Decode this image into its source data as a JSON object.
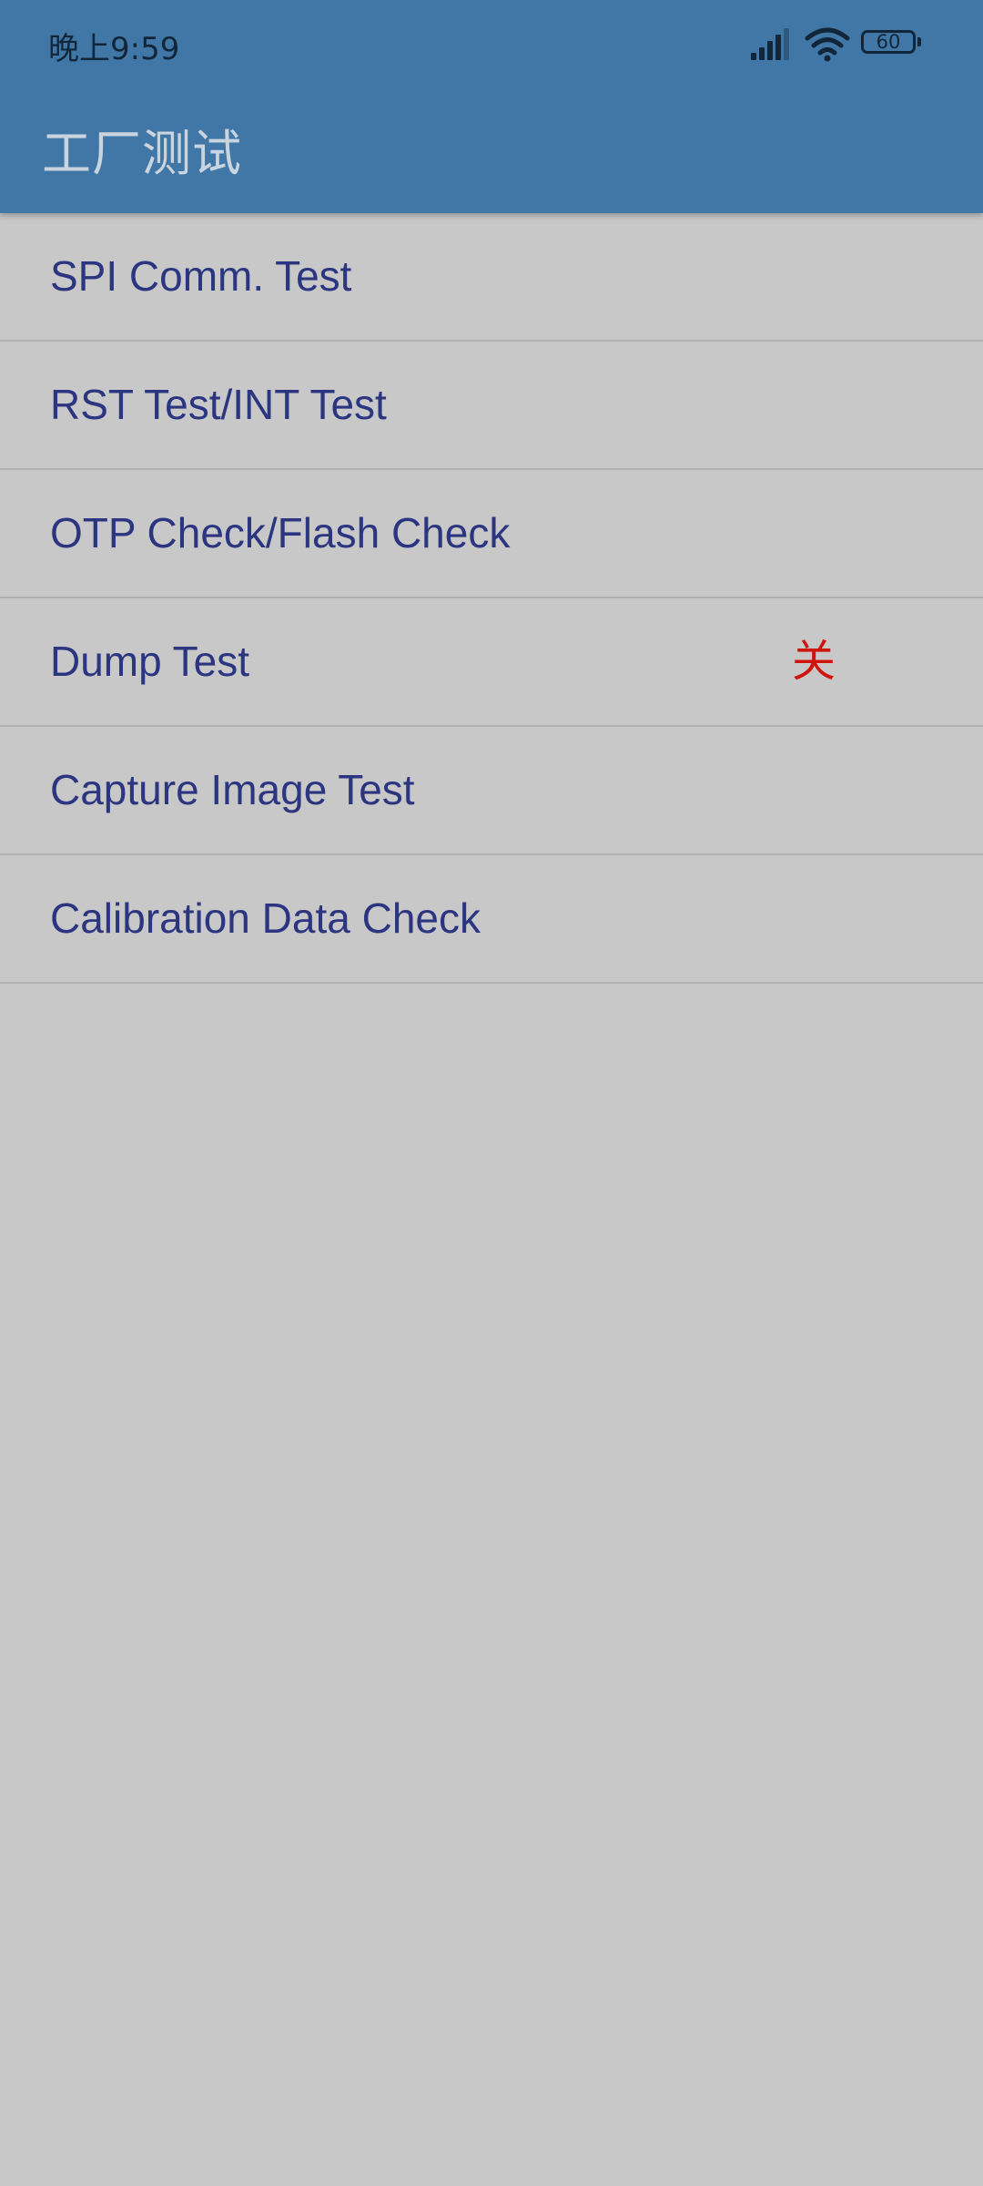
{
  "status_bar": {
    "time": "晚上9:59",
    "battery_level": "60",
    "icons": [
      "signal-icon",
      "wifi-icon",
      "battery-icon"
    ]
  },
  "app_bar": {
    "title": "工厂测试"
  },
  "colors": {
    "header": "#4077a6",
    "background": "#c8c8c8",
    "item_text": "#2b3580",
    "status_off": "#d0150f",
    "divider": "#b2b2b2"
  },
  "test_items": [
    {
      "label": "SPI Comm. Test",
      "status": ""
    },
    {
      "label": "RST Test/INT Test",
      "status": ""
    },
    {
      "label": "OTP Check/Flash Check",
      "status": ""
    },
    {
      "label": "Dump Test",
      "status": "关"
    },
    {
      "label": "Capture Image Test",
      "status": ""
    },
    {
      "label": "Calibration Data Check",
      "status": ""
    }
  ]
}
